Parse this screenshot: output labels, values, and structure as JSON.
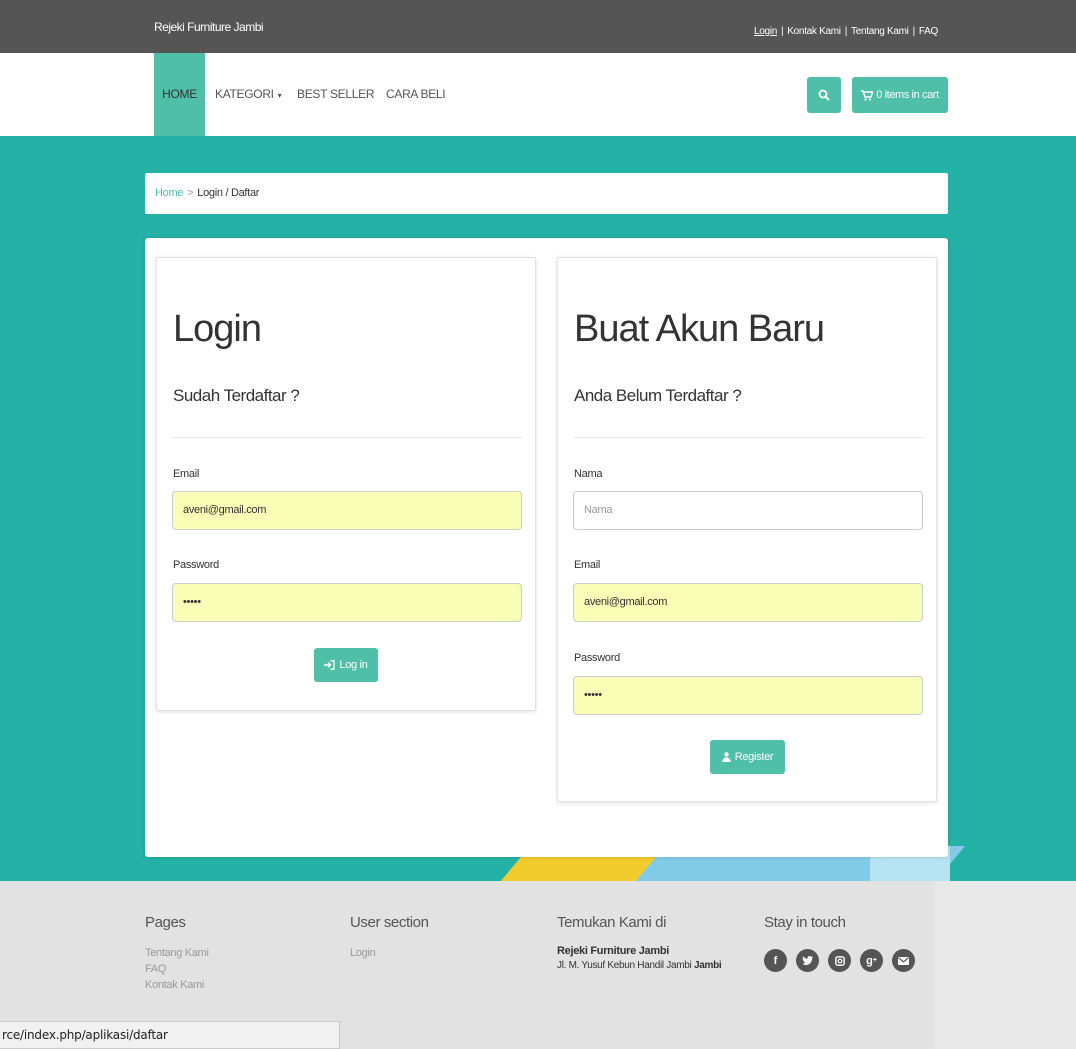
{
  "topbar": {
    "brand": "Rejeki Furniture Jambi",
    "links": [
      "Login",
      "Kontak Kami",
      "Tentang Kami",
      "FAQ"
    ]
  },
  "nav": {
    "items": [
      {
        "label": "HOME",
        "active": true
      },
      {
        "label": "KATEGORI",
        "has_dropdown": true
      },
      {
        "label": "BEST SELLER"
      },
      {
        "label": "CARA BELI"
      }
    ],
    "cart_label": "0 items in cart"
  },
  "breadcrumb": {
    "home": "Home",
    "separator": ">",
    "current": "Login / Daftar"
  },
  "login": {
    "title": "Login",
    "subtitle": "Sudah Terdaftar ?",
    "email_label": "Email",
    "email_value": "aveni@gmail.com",
    "password_label": "Password",
    "password_value": "•••••",
    "button_label": "Log in"
  },
  "register": {
    "title": "Buat Akun Baru",
    "subtitle": "Anda Belum Terdaftar ?",
    "nama_label": "Nama",
    "nama_placeholder": "Nama",
    "email_label": "Email",
    "email_value": "aveni@gmail.com",
    "password_label": "Password",
    "password_value": "•••••",
    "button_label": "Register"
  },
  "footer": {
    "pages": {
      "title": "Pages",
      "links": [
        "Tentang Kami",
        "FAQ",
        "Kontak Kami"
      ]
    },
    "user_section": {
      "title": "User section",
      "links": [
        "Login"
      ]
    },
    "temukan": {
      "title": "Temukan Kami di",
      "company": "Rejeki Furniture Jambi",
      "address": "Jl. M. Yusuf Kebun Handil Jambi",
      "city": "Jambi"
    },
    "stay": {
      "title": "Stay in touch",
      "icons": [
        "facebook-icon",
        "twitter-icon",
        "instagram-icon",
        "google-plus-icon",
        "email-icon"
      ]
    }
  },
  "statusbar": {
    "url": "rce/index.php/aplikasi/daftar"
  },
  "colors": {
    "accent": "#4fbfa8",
    "teal": "#24b1a6",
    "topbar": "#555555",
    "input_fill": "#fafdb5"
  }
}
